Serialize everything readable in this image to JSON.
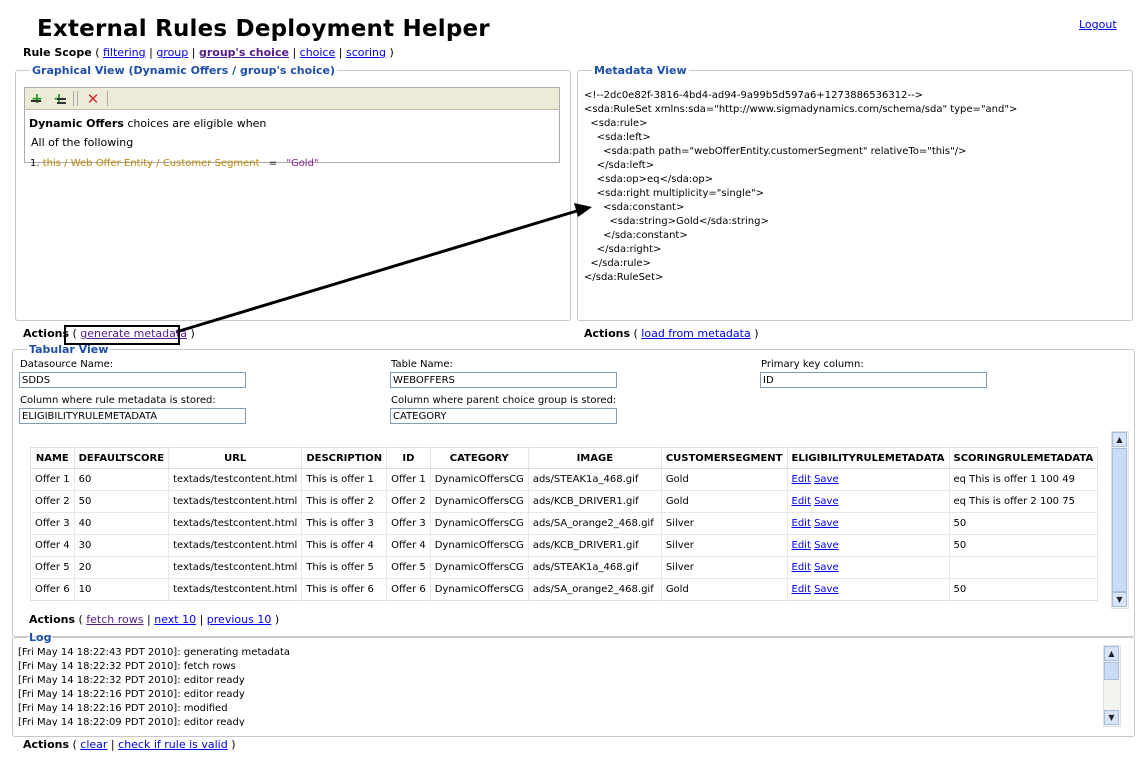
{
  "app": {
    "title": "External Rules Deployment Helper",
    "logout": "Logout"
  },
  "scope": {
    "label": "Rule Scope",
    "items": [
      "filtering",
      "group",
      "group's choice",
      "choice",
      "scoring"
    ],
    "current": "group's choice"
  },
  "graphical": {
    "legend": "Graphical View (Dynamic Offers / group's choice)",
    "sentence_bold": "Dynamic Offers",
    "sentence_rest": " choices are eligible when",
    "all_following": "All of the following",
    "condition": {
      "num": "1.",
      "path": "this / Web Offer Entity / Customer Segment",
      "op": "=",
      "value": "\"Gold\""
    }
  },
  "metadata": {
    "legend": "Metadata View",
    "xml": "<!--2dc0e82f-3816-4bd4-ad94-9a99b5d597a6+1273886536312-->\n<sda:RuleSet xmlns:sda=\"http://www.sigmadynamics.com/schema/sda\" type=\"and\">\n  <sda:rule>\n    <sda:left>\n      <sda:path path=\"webOfferEntity.customerSegment\" relativeTo=\"this\"/>\n    </sda:left>\n    <sda:op>eq</sda:op>\n    <sda:right multiplicity=\"single\">\n      <sda:constant>\n        <sda:string>Gold</sda:string>\n      </sda:constant>\n    </sda:right>\n  </sda:rule>\n</sda:RuleSet>"
  },
  "actions": {
    "label": "Actions",
    "generate": "generate metadata",
    "load": "load from metadata",
    "fetch": "fetch rows",
    "next": "next 10",
    "previous": "previous 10",
    "clear": "clear",
    "check": "check if rule is valid"
  },
  "tabular": {
    "legend": "Tabular View",
    "datasource_label": "Datasource Name:",
    "datasource_value": "SDDS",
    "table_label": "Table Name:",
    "table_value": "WEBOFFERS",
    "pk_label": "Primary key column:",
    "pk_value": "ID",
    "rulecol_label": "Column where rule metadata is stored:",
    "rulecol_value": "ELIGIBILITYRULEMETADATA",
    "parentcol_label": "Column where parent choice group is stored:",
    "parentcol_value": "CATEGORY",
    "columns": [
      "NAME",
      "DEFAULTSCORE",
      "URL",
      "DESCRIPTION",
      "ID",
      "CATEGORY",
      "IMAGE",
      "CUSTOMERSEGMENT",
      "ELIGIBILITYRULEMETADATA",
      "SCORINGRULEMETADATA"
    ],
    "edit_label": "Edit",
    "save_label": "Save",
    "rows": [
      [
        "Offer 1",
        "60",
        "textads/testcontent.html",
        "This is offer 1",
        "Offer 1",
        "DynamicOffersCG",
        "ads/STEAK1a_468.gif",
        "Gold",
        "",
        "eq This is offer 1 100 49"
      ],
      [
        "Offer 2",
        "50",
        "textads/testcontent.html",
        "This is offer 2",
        "Offer 2",
        "DynamicOffersCG",
        "ads/KCB_DRIVER1.gif",
        "Gold",
        "",
        "eq This is offer 2 100 75"
      ],
      [
        "Offer 3",
        "40",
        "textads/testcontent.html",
        "This is offer 3",
        "Offer 3",
        "DynamicOffersCG",
        "ads/SA_orange2_468.gif",
        "Silver",
        "",
        "50"
      ],
      [
        "Offer 4",
        "30",
        "textads/testcontent.html",
        "This is offer 4",
        "Offer 4",
        "DynamicOffersCG",
        "ads/KCB_DRIVER1.gif",
        "Silver",
        "",
        "50"
      ],
      [
        "Offer 5",
        "20",
        "textads/testcontent.html",
        "This is offer 5",
        "Offer 5",
        "DynamicOffersCG",
        "ads/STEAK1a_468.gif",
        "Silver",
        "",
        ""
      ],
      [
        "Offer 6",
        "10",
        "textads/testcontent.html",
        "This is offer 6",
        "Offer 6",
        "DynamicOffersCG",
        "ads/SA_orange2_468.gif",
        "Gold",
        "",
        "50"
      ]
    ]
  },
  "log": {
    "legend": "Log",
    "lines": [
      "[Fri May 14 18:22:43 PDT 2010]: generating metadata",
      "[Fri May 14 18:22:32 PDT 2010]: fetch rows",
      "[Fri May 14 18:22:32 PDT 2010]: editor ready",
      "[Fri May 14 18:22:16 PDT 2010]: editor ready",
      "[Fri May 14 18:22:16 PDT 2010]: modified",
      "[Fri May 14 18:22:09 PDT 2010]: editor ready"
    ]
  },
  "icons": {
    "add_condition": "add-condition-icon",
    "add_group": "add-group-icon",
    "delete": "delete-icon",
    "arrow": "annotation-arrow-icon"
  },
  "colors": {
    "legend": "#1e4fa8",
    "link": "#0000ee",
    "visited": "#551a8b",
    "term": "#b8860b"
  }
}
